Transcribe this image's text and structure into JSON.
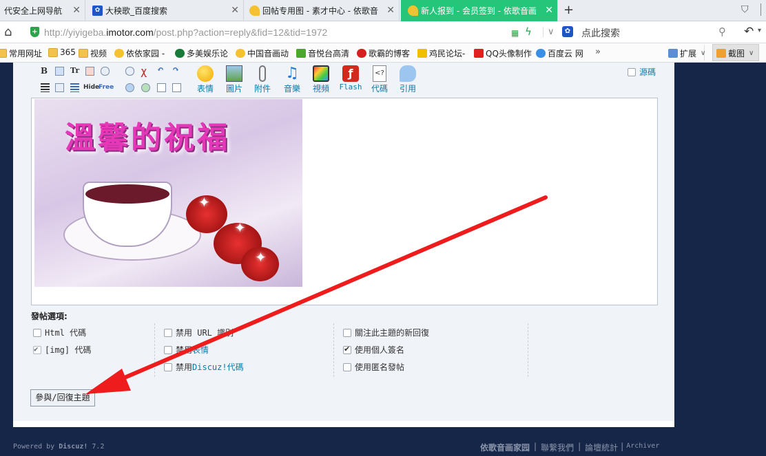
{
  "tabs": [
    {
      "title": "代安全上网导航",
      "favicon": "none"
    },
    {
      "title": "大秧歌_百度搜索",
      "favicon": "baidu-paw"
    },
    {
      "title": "回帖专用图 - 素才中心 - 依歌音",
      "favicon": "heart"
    },
    {
      "title": "新人报到 - 会员签到 - 依歌音画",
      "favicon": "heart",
      "active": true
    }
  ],
  "address": {
    "url_prefix": "http://yiyigeba.",
    "url_host": "imotor.com",
    "url_path": "/post.php?action=reply&fid=12&tid=1972",
    "search_placeholder": "点此搜索"
  },
  "bookmarks": [
    "常用网址",
    "365",
    "视频",
    "依依家园 -",
    "多美娱乐论",
    "中国音画动",
    "音悦台高清",
    "歌霸的博客",
    "鸡民论坛-",
    "QQ头像制作",
    "百度云 网"
  ],
  "bookmark_more": "»",
  "extensions": {
    "label": "扩展",
    "screenshot": "截图"
  },
  "toolbar": {
    "bold": "B",
    "tools": [
      {
        "label": "表情",
        "icon": "smiley-icon"
      },
      {
        "label": "圖片",
        "icon": "image-icon"
      },
      {
        "label": "附件",
        "icon": "paperclip-icon"
      },
      {
        "label": "音樂",
        "icon": "music-icon"
      },
      {
        "label": "視頻",
        "icon": "video-icon"
      },
      {
        "label": "Flash",
        "icon": "flash-icon"
      },
      {
        "label": "代碼",
        "icon": "code-icon"
      },
      {
        "label": "引用",
        "icon": "quote-icon"
      }
    ],
    "source_label": "源碼",
    "small_labels": [
      "Hide",
      "Free"
    ]
  },
  "editor": {
    "image_title": "溫馨的祝福"
  },
  "options": {
    "title": "發帖選項:",
    "col1": [
      {
        "label": "Html 代碼",
        "checked": false
      },
      {
        "label": "[img] 代碼",
        "checked": true
      }
    ],
    "col2": [
      {
        "label_plain": "禁用 URL 識別",
        "label_link": "",
        "checked": false
      },
      {
        "label_plain": "禁用 ",
        "label_link": "表情",
        "checked": false
      },
      {
        "label_plain": "禁用 ",
        "label_link": "Discuz!代碼",
        "checked": false
      }
    ],
    "col3": [
      {
        "label": "關注此主題的新回復",
        "checked": false
      },
      {
        "label": "使用個人簽名",
        "checked": true
      },
      {
        "label": "使用匿名發帖",
        "checked": false
      }
    ]
  },
  "submit_label": "參與/回復主題",
  "footer": {
    "powered_prefix": "Powered by ",
    "powered_brand": "Discuz!",
    "powered_version": " 7.2",
    "links": [
      "依歌音画家园",
      "聯繫我們",
      "論壇統計",
      "Archiver"
    ],
    "separator": "|"
  },
  "colors": {
    "active_tab": "#26c67a",
    "page_bg": "#162649",
    "link": "#0f7aa8",
    "annotation_arrow": "#ee1c1c"
  }
}
